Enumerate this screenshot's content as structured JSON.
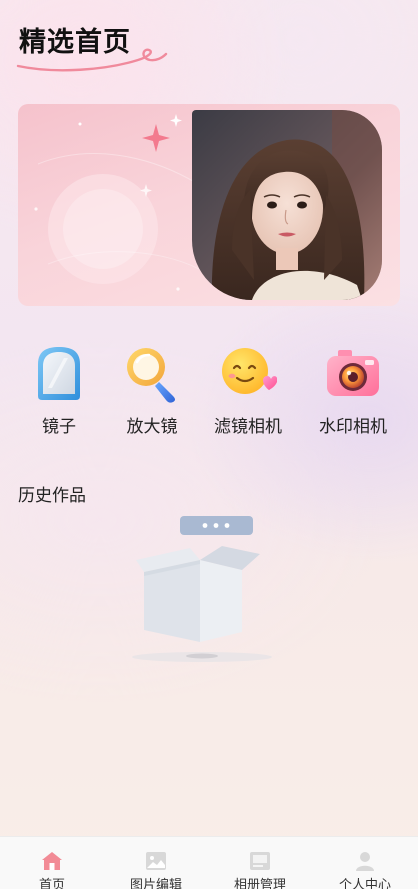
{
  "header": {
    "title": "精选首页"
  },
  "banner": {
    "image": "portrait-photo"
  },
  "tools": [
    {
      "label": "镜子",
      "icon": "mirror-icon"
    },
    {
      "label": "放大镜",
      "icon": "magnifier-icon"
    },
    {
      "label": "滤镜相机",
      "icon": "emoji-filter-icon"
    },
    {
      "label": "水印相机",
      "icon": "camera-icon"
    }
  ],
  "history": {
    "title": "历史作品",
    "empty_icon": "empty-box-icon"
  },
  "bottom_nav": [
    {
      "label": "首页",
      "icon": "home-icon",
      "active": true
    },
    {
      "label": "图片编辑",
      "icon": "image-icon",
      "active": false
    },
    {
      "label": "相册管理",
      "icon": "album-icon",
      "active": false
    },
    {
      "label": "个人中心",
      "icon": "user-icon",
      "active": false
    }
  ],
  "colors": {
    "accent": "#f08a9c",
    "nav_active_icon": "#f28b96",
    "nav_inactive_icon": "#d8d8d8"
  }
}
